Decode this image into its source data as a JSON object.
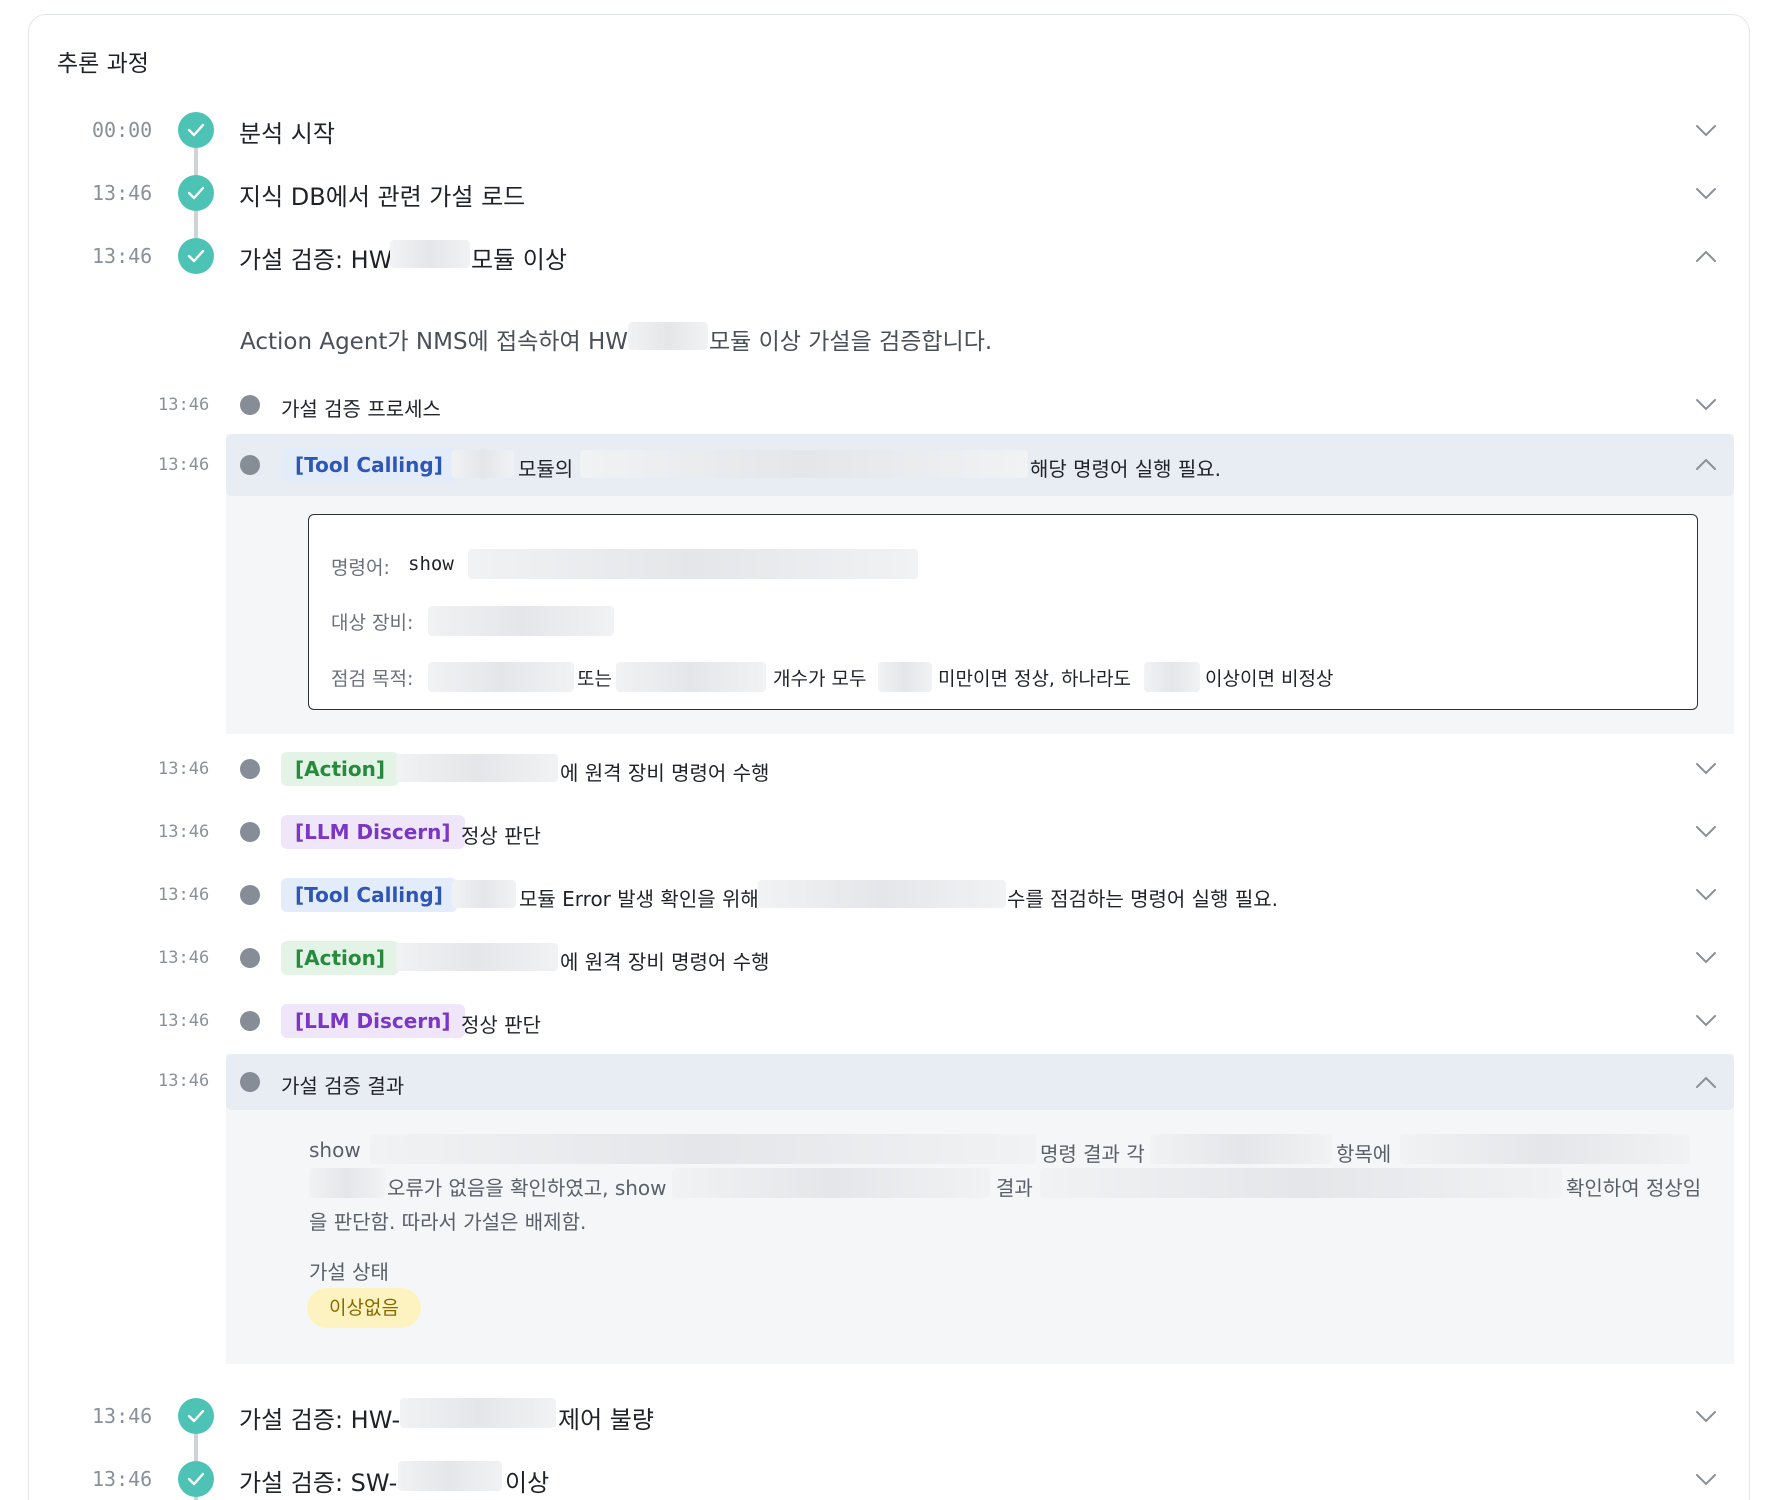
{
  "panel": {
    "title": "추론 과정"
  },
  "steps": [
    {
      "time": "00:00",
      "title": "분석 시작"
    },
    {
      "time": "13:46",
      "title": "지식 DB에서 관련 가설 로드"
    },
    {
      "time": "13:46",
      "title_prefix": "가설 검증: HW·",
      "title_suffix": "모듈 이상"
    }
  ],
  "expanded": {
    "description_prefix": "Action Agent가 NMS에 접속하여 HW",
    "description_suffix": "모듈 이상 가설을 검증합니다.",
    "sub": [
      {
        "time": "13:46",
        "text": "가설 검증 프로세스"
      },
      {
        "time": "13:46",
        "tag": "[Tool Calling]",
        "t1": "모듈의",
        "t2": "해당 명령어 실행 필요."
      },
      {
        "time": "13:46",
        "tag": "[Action]",
        "t1": "에 원격 장비 명령어 수행"
      },
      {
        "time": "13:46",
        "tag": "[LLM Discern]",
        "t1": "정상 판단"
      },
      {
        "time": "13:46",
        "tag": "[Tool Calling]",
        "t1": "모듈 Error 발생 확인을 위해",
        "t2": "수를 점검하는 명령어 실행 필요."
      },
      {
        "time": "13:46",
        "tag": "[Action]",
        "t1": "에 원격 장비 명령어 수행"
      },
      {
        "time": "13:46",
        "tag": "[LLM Discern]",
        "t1": "정상 판단"
      },
      {
        "time": "13:46",
        "text": "가설 검증 결과"
      }
    ],
    "command": {
      "cmd_label": "명령어:",
      "cmd_value": "show",
      "target_label": "대상 장비:",
      "purpose_label": "점검 목적:",
      "purpose_or": "또는",
      "purpose_count": "개수가 모두",
      "purpose_normal": "미만이면 정상, 하나라도",
      "purpose_abnormal": "이상이면 비정상"
    },
    "result": {
      "l1_show": "show",
      "l1_mid": "명령 결과 각",
      "l1_end": "항목에",
      "l2_a": "오류가 없음을 확인하였고, show",
      "l2_b": "결과",
      "l2_c": "확인하여 정상임",
      "l3": "을 판단함. 따라서 가설은 배제함.",
      "status_label": "가설 상태",
      "status_value": "이상없음"
    }
  },
  "later_steps": [
    {
      "time": "13:46",
      "title_prefix": "가설 검증: HW-",
      "title_suffix": "제어 불량"
    },
    {
      "time": "13:46",
      "title_prefix": "가설 검증: SW-",
      "title_suffix": "이상"
    }
  ],
  "colors": {
    "check": "#4dc3b5",
    "dot": "#878d96",
    "tool_tag": "#2f56b4",
    "action_tag": "#278a3f",
    "llm_tag": "#7a37c6",
    "status_badge": "#fdf3c0"
  }
}
